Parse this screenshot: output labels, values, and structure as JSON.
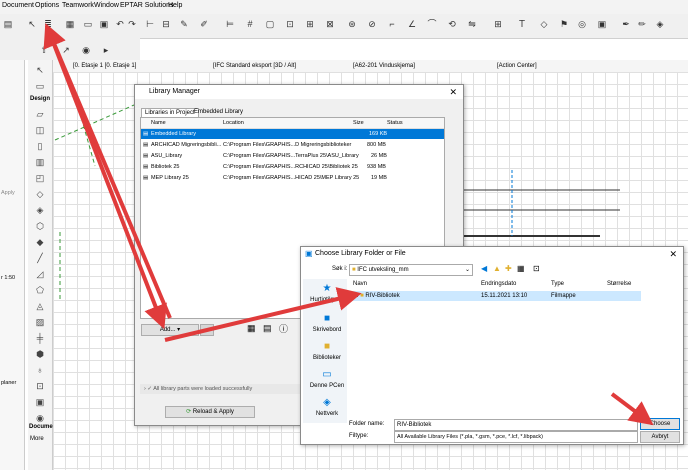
{
  "menubar": {
    "items": [
      "Document",
      "Options",
      "Teamwork",
      "Window",
      "EPTAR Solutions",
      "Help"
    ]
  },
  "panels": {
    "design_label": "Design",
    "apply_label": "Apply",
    "scale_label": "r 1:50",
    "planer_label": "planer",
    "docume_label": "Docume",
    "more_label": "More"
  },
  "tabs": [
    "[0. Etasje 1 [0. Etasje 1]",
    "[IFC Standard eksport [3D / Alt]",
    "[A62-201 Vinduskjema]",
    "[Action Center]"
  ],
  "library_manager": {
    "title": "Library Manager",
    "tabs": [
      "Libraries in Project",
      "Embedded Library"
    ],
    "columns": [
      "Name",
      "Location",
      "Size",
      "Status"
    ],
    "rows": [
      {
        "name": "Embedded Library",
        "location": "",
        "size": "169 KB",
        "status": ""
      },
      {
        "name": "ARCHICAD Migreringsbibli...",
        "location": "C:\\Program Files\\GRAPHIS...D Migreringsbiblioteker",
        "size": "800 MB",
        "status": ""
      },
      {
        "name": "ASU_Library",
        "location": "C:\\Program Files\\GRAPHIS...TerraPlus 25\\ASU_Library",
        "size": "26 MB",
        "status": ""
      },
      {
        "name": "Bibliotek 25",
        "location": "C:\\Program Files\\GRAPHIS...RCHICAD 25\\Bibliotek 25",
        "size": "938 MB",
        "status": ""
      },
      {
        "name": "MEP Library 25",
        "location": "C:\\Program Files\\GRAPHIS...HICAD 25\\MEP Library 25",
        "size": "19 MB",
        "status": ""
      }
    ],
    "add_button": "Add...",
    "status_text": "All library parts were loaded successfully",
    "reload_button": "Reload & Apply"
  },
  "choose_folder": {
    "title": "Choose Library Folder or File",
    "look_in_label": "Søk i:",
    "look_in_value": "IFC utveksling_mm",
    "columns": [
      "Navn",
      "Endringsdato",
      "Type",
      "Størrelse"
    ],
    "places": [
      "Hurtigtilgang",
      "Skrivebord",
      "Biblioteker",
      "Denne PCen",
      "Nettverk"
    ],
    "rows": [
      {
        "name": "RIV-Bibliotek",
        "date": "15.11.2021 13:10",
        "type": "Filmappe",
        "size": ""
      }
    ],
    "folder_name_label": "Folder name:",
    "folder_name_value": "RIV-Bibliotek",
    "filetype_label": "Filtype:",
    "filetype_value": "All Available Library Files (*.pla, *.gsm, *.pce, *.lcf, *.libpack)",
    "choose_button": "Choose",
    "cancel_button": "Avbryt"
  },
  "colors": {
    "accent": "#0078d7",
    "arrow": "#e03b3b",
    "dashed_green": "#3a9a3a"
  }
}
